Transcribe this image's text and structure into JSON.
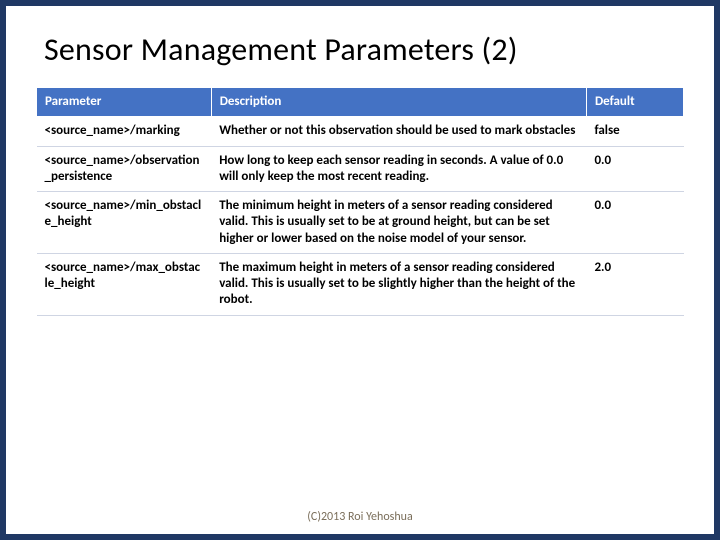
{
  "title": "Sensor Management Parameters (2)",
  "columns": {
    "param": "Parameter",
    "desc": "Description",
    "def": "Default"
  },
  "rows": [
    {
      "param": "<source_name>/marking",
      "desc": "Whether or not this observation should be used to mark obstacles",
      "def": "false"
    },
    {
      "param": "<source_name>/observation_persistence",
      "desc": "How long to keep each sensor reading in seconds. A value of 0.0 will only keep the most recent reading.",
      "def": "0.0"
    },
    {
      "param": "<source_name>/min_obstacle_height",
      "desc": "The minimum height in meters of a sensor reading considered valid. This is usually set to be at ground height, but can be set higher or lower based on the noise model of your sensor.",
      "def": "0.0"
    },
    {
      "param": "<source_name>/max_obstacle_height",
      "desc": "The maximum height in meters of a sensor reading considered valid. This is usually set to be slightly higher than the height of the robot.",
      "def": "2.0"
    }
  ],
  "footer": "(C)2013 Roi Yehoshua"
}
